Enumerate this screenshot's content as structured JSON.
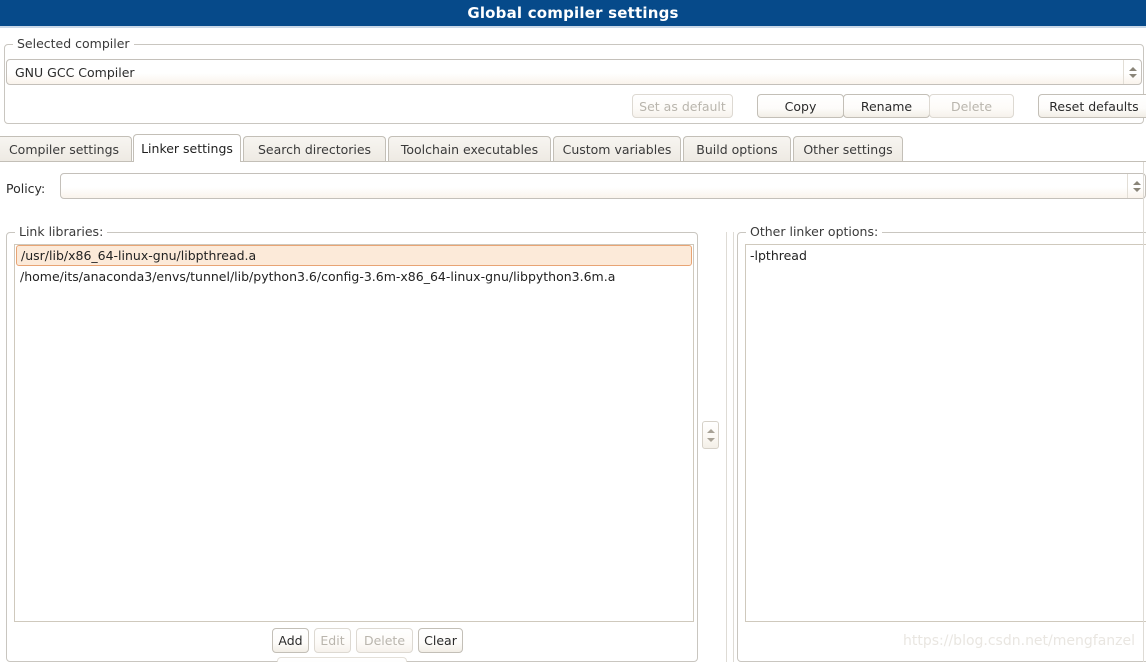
{
  "window": {
    "title": "Global compiler settings"
  },
  "selected_compiler": {
    "group_label": "Selected compiler",
    "value": "GNU GCC Compiler",
    "spinner_up_icon": "triangle-up-icon",
    "spinner_down_icon": "triangle-down-icon"
  },
  "compiler_actions": [
    {
      "label": "Set as default",
      "enabled": false
    },
    {
      "label": "Copy",
      "enabled": true
    },
    {
      "label": "Rename",
      "enabled": true
    },
    {
      "label": "Delete",
      "enabled": false
    },
    {
      "label": "Reset defaults",
      "enabled": true
    }
  ],
  "tabs": [
    {
      "label": "Compiler settings",
      "active": false
    },
    {
      "label": "Linker settings",
      "active": true
    },
    {
      "label": "Search directories",
      "active": false
    },
    {
      "label": "Toolchain executables",
      "active": false
    },
    {
      "label": "Custom variables",
      "active": false
    },
    {
      "label": "Build options",
      "active": false
    },
    {
      "label": "Other settings",
      "active": false
    }
  ],
  "policy": {
    "label": "Policy:",
    "value": "",
    "spinner_up_icon": "triangle-up-icon",
    "spinner_down_icon": "triangle-down-icon"
  },
  "link_libraries": {
    "group_label": "Link libraries:",
    "items": [
      {
        "path": "/usr/lib/x86_64-linux-gnu/libpthread.a",
        "selected": true
      },
      {
        "path": "/home/its/anaconda3/envs/tunnel/lib/python3.6/config-3.6m-x86_64-linux-gnu/libpython3.6m.a",
        "selected": false
      }
    ],
    "buttons": [
      {
        "label": "Add",
        "enabled": true
      },
      {
        "label": "Edit",
        "enabled": false
      },
      {
        "label": "Delete",
        "enabled": false
      },
      {
        "label": "Clear",
        "enabled": true
      }
    ],
    "reorder_spinner": {
      "up_icon": "triangle-up-icon",
      "down_icon": "triangle-down-icon"
    }
  },
  "other_linker_options": {
    "group_label": "Other linker options:",
    "value": "-lpthread"
  },
  "watermark": {
    "text": "https://blog.csdn.net/mengfanzel"
  },
  "colors": {
    "titlebar_bg": "#064a8a",
    "titlebar_fg": "#ffffff",
    "selection_bg": "#fcead9",
    "selection_border": "#e8a474",
    "groupbox_border": "#c9c6c0",
    "button_border": "#c3bfb7",
    "disabled_text": "#b9b5ad"
  }
}
